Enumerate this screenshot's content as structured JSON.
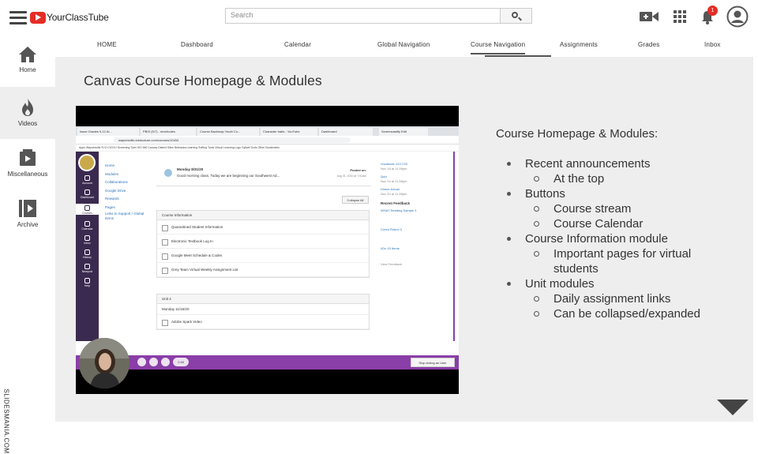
{
  "header": {
    "brand": "YourClassTube",
    "search_placeholder": "Search",
    "notification_count": "1"
  },
  "rail": {
    "items": [
      {
        "label": "Home"
      },
      {
        "label": "Videos"
      },
      {
        "label": "Miscellaneous"
      },
      {
        "label": "Archive"
      }
    ],
    "watermark": "SLIDESMANIA.COM"
  },
  "nav": {
    "tabs": [
      {
        "label": "HOME"
      },
      {
        "label": "Dashboard"
      },
      {
        "label": "Calendar"
      },
      {
        "label": "Global Navigation"
      },
      {
        "label": "Course Navigation"
      },
      {
        "label": "Assignments"
      },
      {
        "label": "Grades"
      },
      {
        "label": "Inbox"
      }
    ],
    "active": "Course Navigation"
  },
  "main": {
    "title": "Canvas Course Homepage & Modules",
    "notes_heading": "Course Homepage & Modules:",
    "bullets": [
      {
        "text": "Recent announcements",
        "sub": [
          "At the top"
        ]
      },
      {
        "text": "Buttons",
        "sub": [
          "Course stream",
          "Course Calendar"
        ]
      },
      {
        "text": "Course Information module",
        "sub": [
          "Important pages for virtual students"
        ]
      },
      {
        "text": "Unit modules",
        "sub": [
          "Daily assignment links",
          "Can be collapsed/expanded"
        ]
      }
    ]
  },
  "video": {
    "tabs": [
      "Issue Grades 9-12 Al...",
      "PBIS (5/7) - mrsrhodes",
      "Course Backmap Youth Co...",
      "Character traits - YouTube",
      "Dashboard",
      "Screencastify Edit"
    ],
    "url": "waynesville.instructure.com/courses/10434",
    "bookmarks": "Apps   Waynesville R-VI   CIO/VJ Screening   Tyler SIS 360   Canvas   District Sites   Nebraska Learning   Softing Tools   Virtual Learning   Logo   Syllabi Tools   Other Bookmarks",
    "course_nav": [
      "Home",
      "Modules",
      "Collaborations",
      "Google Drive",
      "Rewards",
      "Pages",
      "Links to Support / Global Items"
    ],
    "canvas_side": [
      "Account",
      "Dashboard",
      "Courses",
      "Calendar",
      "Inbox",
      "History",
      "Nearpod",
      "Help"
    ],
    "post_date": "Monday 8/31/20",
    "post_text": "Good morning class. Today we are beginning our Southwest Ad...",
    "posted_on": "Posted on:",
    "posted_date": "Aug 31, 2020 at 7:51am",
    "collapse_all": "Collapse All",
    "course_info_header": "Course Information",
    "course_info_items": [
      "Quarantined Student Information",
      "Electronic Textbook Log In",
      "Google Meet Schedule & Codes",
      "Grey Team Virtual Weekly Assignment List"
    ],
    "unit_header": "Unit 4",
    "unit_day": "Monday 11/16/20",
    "unit_item": "Adobe Spark Video",
    "right_todo": [
      "Vocabular 11/17/20",
      "Quiz",
      "Dinner Actual"
    ],
    "right_todo_sub": [
      "Nov 18 at 11:59pm",
      "Nov 19 at 11:59pm",
      "Nov 20 at 11:59pm"
    ],
    "recent_feedback": "Recent Feedback",
    "feedback_items": [
      "WHAT Reading Sample 1",
      "Creed Rubric 3",
      "I/Do 15 Items"
    ],
    "view_more": "View Feedback",
    "time": "2:48",
    "stop_acting": "Stop Acting as User"
  }
}
